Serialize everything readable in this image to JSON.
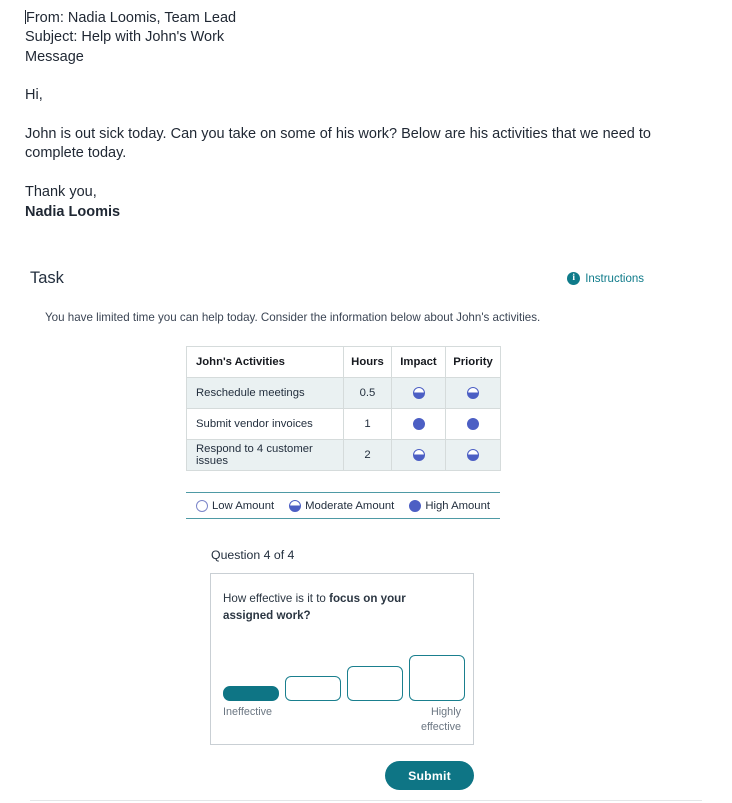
{
  "email": {
    "from_line": "From: Nadia Loomis, Team Lead",
    "subject_line": "Subject: Help with John's Work",
    "message_label": "Message",
    "greeting": "Hi,",
    "body": "John is out sick today. Can you take on some of his work? Below are his activities that we need to complete today.",
    "closing": "Thank you,",
    "signature": "Nadia Loomis"
  },
  "task": {
    "title": "Task",
    "instructions_label": "Instructions",
    "instructions_icon": "info-circle-icon",
    "intro": "You have limited time you can help today. Consider the information below about John's activities."
  },
  "table": {
    "headers": [
      "John's Activities",
      "Hours",
      "Impact",
      "Priority"
    ],
    "rows": [
      {
        "activity": "Reschedule meetings",
        "hours": "0.5",
        "impact": "moderate",
        "priority": "moderate"
      },
      {
        "activity": "Submit vendor invoices",
        "hours": "1",
        "impact": "high",
        "priority": "high"
      },
      {
        "activity": "Respond to 4 customer issues",
        "hours": "2",
        "impact": "moderate",
        "priority": "moderate"
      }
    ]
  },
  "legend": {
    "items": [
      {
        "level": "low",
        "label": "Low Amount"
      },
      {
        "level": "moderate",
        "label": "Moderate Amount"
      },
      {
        "level": "high",
        "label": "High Amount"
      }
    ]
  },
  "question": {
    "counter": "Question 4 of 4",
    "prompt_prefix": "How effective is it to ",
    "prompt_bold": "focus on your assigned work?",
    "scale": {
      "low_label": "Ineffective",
      "high_label_line1": "Highly",
      "high_label_line2": "effective",
      "options": [
        "1",
        "2",
        "3",
        "4"
      ],
      "selected_index": 0
    }
  },
  "footer": {
    "submit_label": "Submit"
  },
  "colors": {
    "accent_teal": "#0e7585",
    "legend_rule": "#4e9aa5",
    "dot_blue": "#4c5fc4",
    "table_row_alt": "#eaf1f2",
    "text_dark": "#232f3e"
  }
}
